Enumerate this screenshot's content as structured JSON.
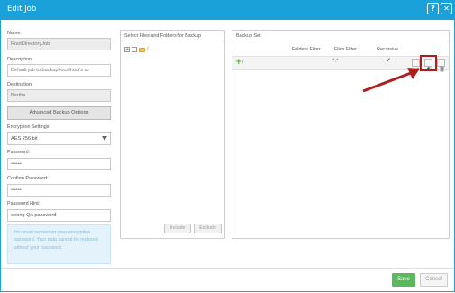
{
  "window": {
    "title": "Edit Job",
    "help_label": "?",
    "close_label": "✕",
    "accent": "#1ba1d9"
  },
  "form": {
    "name_label": "Name:",
    "name_value": "RootDirectoryJob",
    "description_label": "Description:",
    "description_value": "Default job to backup localhost's ro",
    "destination_label": "Destination:",
    "destination_value": "Bertha",
    "advanced_button_label": "Advanced Backup Options",
    "encryption_label": "Encryption Settings:",
    "encryption_value": "AES 256 bit",
    "password_label": "Password:",
    "password_value": "••••••",
    "confirm_password_label": "Confirm Password:",
    "confirm_password_value": "••••••",
    "password_hint_label": "Password Hint:",
    "password_hint_value": "strong QA password",
    "info_text": "You must remember your encryption password. Your data cannot be restored without your password."
  },
  "files_panel": {
    "title": "Select Files and Folders for Backup",
    "tree_root_label": "/",
    "include_label": "Include",
    "exclude_label": "Exclude"
  },
  "backup_set": {
    "title": "Backup Set",
    "columns": [
      "Folders Filter",
      "Files Filter",
      "Recursive"
    ],
    "rows": [
      {
        "path": "/",
        "folders_filter": "",
        "files_filter": "*.*",
        "recursive": "✔"
      }
    ]
  },
  "footer": {
    "save_label": "Save",
    "cancel_label": "Cancel",
    "save_color": "#5cb85c"
  },
  "annotation": {
    "arrow_color": "#b01d1d"
  }
}
